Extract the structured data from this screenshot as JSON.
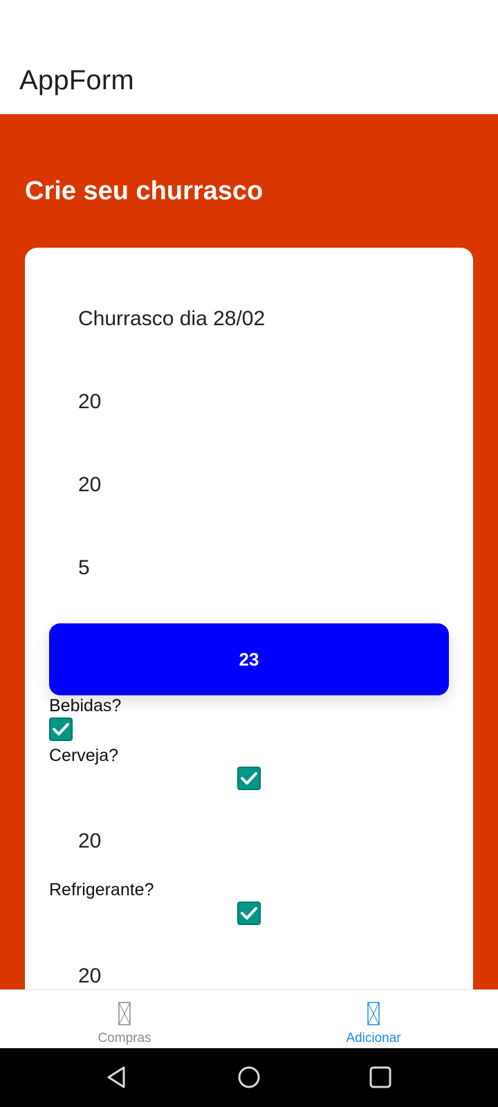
{
  "app_bar": {
    "title": "AppForm"
  },
  "page": {
    "headline": "Crie seu churrasco"
  },
  "form": {
    "event_name": "Churrasco dia 28/02",
    "field_2": "20",
    "field_3": "20",
    "field_4": "5",
    "button_label": "23",
    "drinks": {
      "label": "Bebidas?",
      "checked": true,
      "beer": {
        "label": "Cerveja?",
        "checked": true,
        "quantity": "20"
      },
      "soda": {
        "label": "Refrigerante?",
        "checked": true,
        "quantity": "20"
      }
    }
  },
  "tabs": [
    {
      "label": "Compras",
      "active": false
    },
    {
      "label": "Adicionar",
      "active": true
    }
  ],
  "colors": {
    "header_bg": "#d93600",
    "button_bg": "#0000ff",
    "checkbox": "#009688",
    "active_tab": "#1e88e5",
    "inactive_tab": "#8a8a8a"
  }
}
